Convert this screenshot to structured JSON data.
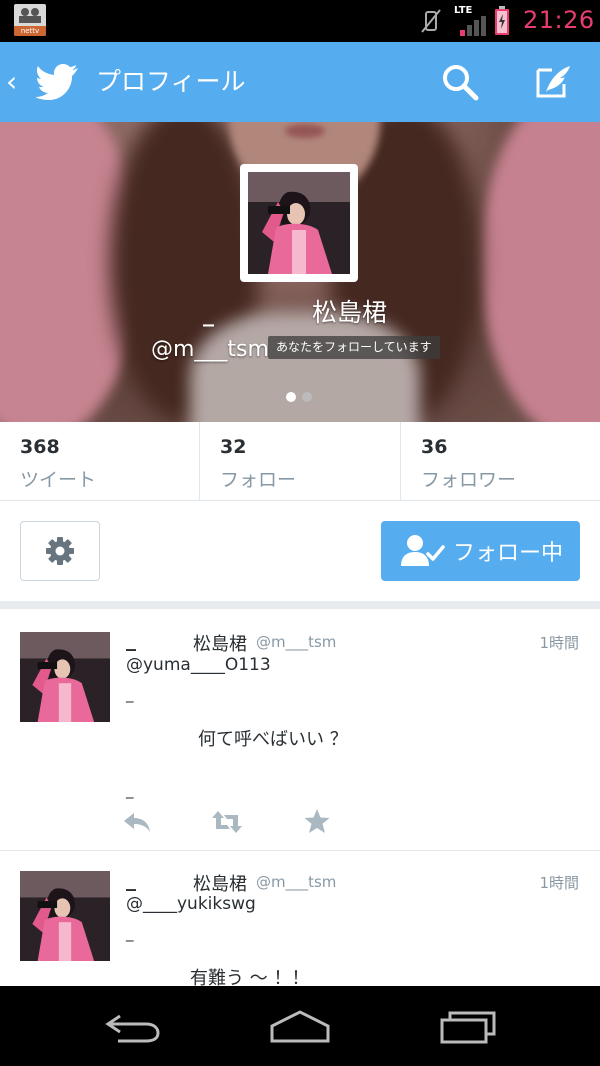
{
  "status_bar": {
    "app_label": "nettv",
    "network": "LTE",
    "time": "21:26",
    "colors": {
      "time": "#e83d6e"
    }
  },
  "action_bar": {
    "title": "プロフィール",
    "icons": [
      "back-icon",
      "twitter-bird-icon",
      "search-icon",
      "compose-icon"
    ],
    "colors": {
      "background": "#55acee"
    }
  },
  "profile": {
    "name_prefix": "_",
    "display_name": "松島桾",
    "handle": "@m___tsm",
    "follows_you": "あなたをフォローしています",
    "pager": {
      "pages": 2,
      "active": 0
    }
  },
  "stats": [
    {
      "count": "368",
      "label": "ツイート"
    },
    {
      "count": "32",
      "label": "フォロー"
    },
    {
      "count": "36",
      "label": "フォロワー"
    }
  ],
  "actions": {
    "settings_icon": "gear-icon",
    "follow_button": "フォロー中",
    "follow_icon": "person-check-icon"
  },
  "tweets": [
    {
      "name_prefix": "_",
      "name": "松島桾",
      "handle": "@m___tsm",
      "time": "1時間",
      "reply_to": "@yuma____O113",
      "line_1": "_",
      "text": "何て呼べばいい ？",
      "line_2": "_"
    },
    {
      "name_prefix": "_",
      "name": "松島桾",
      "handle": "@m___tsm",
      "time": "1時間",
      "reply_to": "@____yukikswg",
      "line_1": "_",
      "text": "有難う ～ ！！"
    }
  ],
  "tweet_actions": [
    "reply-icon",
    "retweet-icon",
    "favorite-icon"
  ],
  "nav_bar": {
    "icons": [
      "back-nav-icon",
      "home-nav-icon",
      "recents-nav-icon"
    ]
  }
}
